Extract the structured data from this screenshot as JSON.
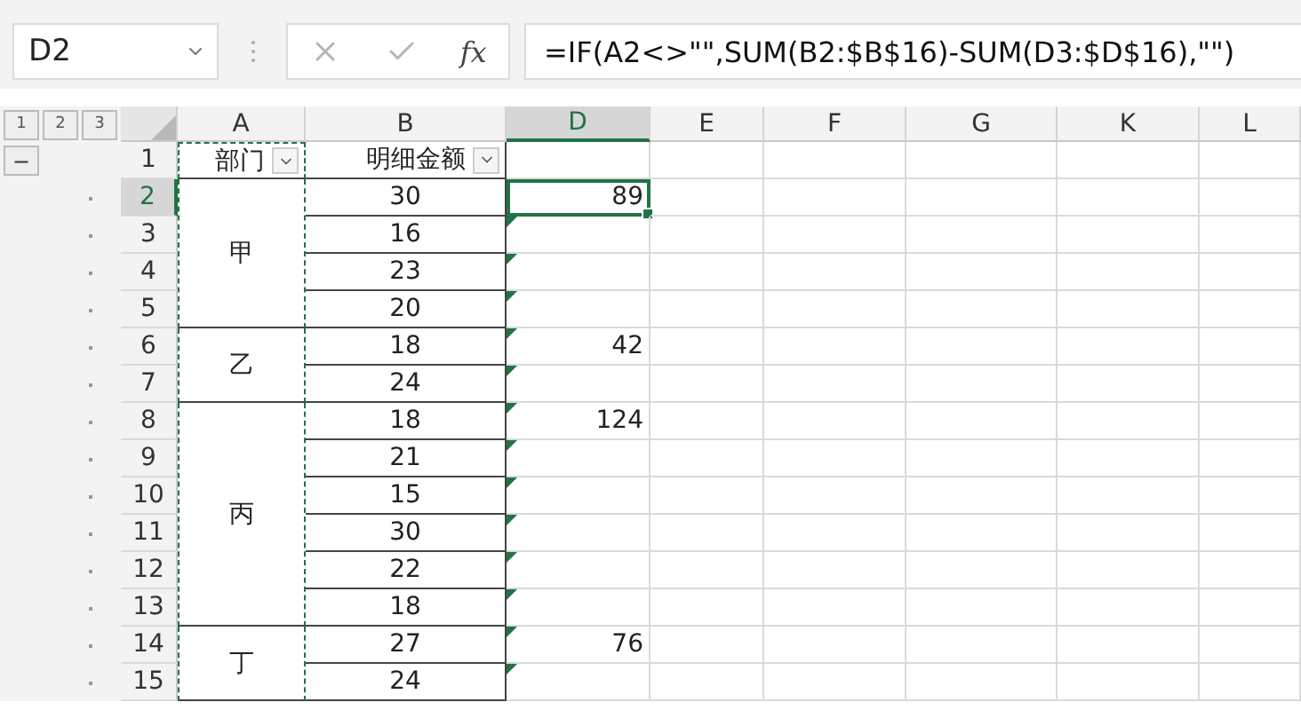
{
  "name_box": {
    "value": "D2"
  },
  "formula_bar": {
    "cancel_enabled": false,
    "enter_enabled": false,
    "function_label": "fx",
    "formula": "=IF(A2<>\"\",SUM(B2:$B$16)-SUM(D3:$D$16),\"\")"
  },
  "outline": {
    "levels": [
      "1",
      "2",
      "3"
    ],
    "toggle": "−"
  },
  "columns": [
    {
      "label": "A",
      "selected": false
    },
    {
      "label": "B",
      "selected": false
    },
    {
      "label": "D",
      "selected": true
    },
    {
      "label": "E",
      "selected": false
    },
    {
      "label": "F",
      "selected": false
    },
    {
      "label": "G",
      "selected": false
    },
    {
      "label": "K",
      "selected": false
    },
    {
      "label": "L",
      "selected": false
    }
  ],
  "header_row": {
    "number": "1",
    "a": "部门",
    "b": "明细金额",
    "filter_a": true,
    "filter_b": true
  },
  "groups": [
    {
      "label": "甲",
      "rows": [
        {
          "number": "2",
          "selected": true,
          "b": "30",
          "d": "89",
          "flag": false
        },
        {
          "number": "3",
          "selected": false,
          "b": "16",
          "flag": true
        },
        {
          "number": "4",
          "selected": false,
          "b": "23",
          "flag": true
        },
        {
          "number": "5",
          "selected": false,
          "b": "20",
          "flag": true
        }
      ]
    },
    {
      "label": "乙",
      "rows": [
        {
          "number": "6",
          "selected": false,
          "b": "18",
          "d": "42",
          "flag": true
        },
        {
          "number": "7",
          "selected": false,
          "b": "24",
          "flag": true
        }
      ]
    },
    {
      "label": "丙",
      "rows": [
        {
          "number": "8",
          "selected": false,
          "b": "18",
          "d": "124",
          "flag": true
        },
        {
          "number": "9",
          "selected": false,
          "b": "21",
          "flag": true
        },
        {
          "number": "10",
          "selected": false,
          "b": "15",
          "flag": true
        },
        {
          "number": "11",
          "selected": false,
          "b": "30",
          "flag": true
        },
        {
          "number": "12",
          "selected": false,
          "b": "22",
          "flag": true
        },
        {
          "number": "13",
          "selected": false,
          "b": "18",
          "flag": true
        }
      ]
    },
    {
      "label": "丁",
      "rows": [
        {
          "number": "14",
          "selected": false,
          "b": "27",
          "d": "76",
          "flag": true
        },
        {
          "number": "15",
          "selected": false,
          "b": "24",
          "flag": true
        }
      ]
    }
  ]
}
